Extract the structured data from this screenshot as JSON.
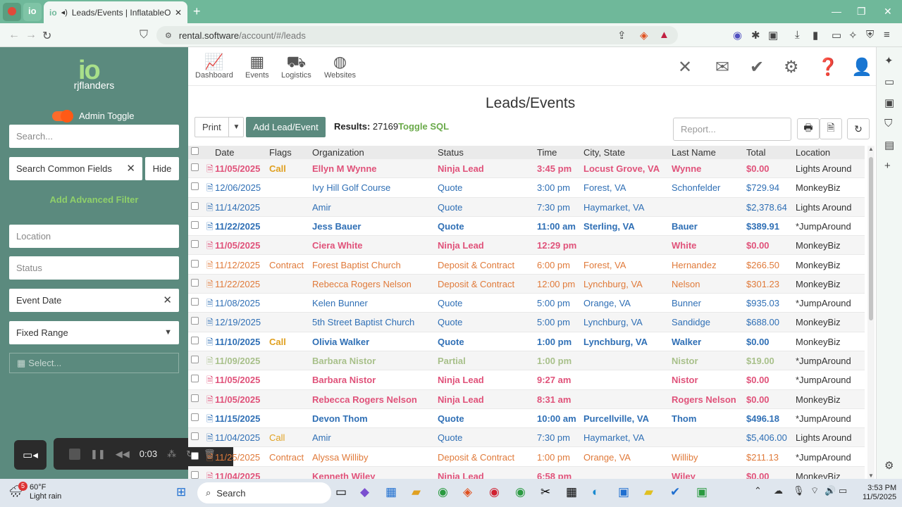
{
  "browser": {
    "tab_title": "Leads/Events | InflatableOffic",
    "url_host": "rental.software",
    "url_path": "/account/#/leads"
  },
  "sidebar": {
    "logo": "io",
    "username": "rjflanders",
    "admin_toggle_label": "Admin Toggle",
    "search_placeholder": "Search...",
    "common_fields_value": "Search Common Fields",
    "hide_label": "Hide",
    "advanced_filter_label": "Add Advanced Filter",
    "location_placeholder": "Location",
    "status_placeholder": "Status",
    "event_date_value": "Event Date",
    "range_selected": "Fixed Range",
    "select_placeholder": "Select..."
  },
  "recorder": {
    "time": "0:03"
  },
  "topnav": {
    "items": [
      "Dashboard",
      "Events",
      "Logistics",
      "Websites"
    ]
  },
  "page": {
    "title": "Leads/Events",
    "print_label": "Print",
    "add_label": "Add Lead/Event",
    "results_label": "Results:",
    "results_count": "27169",
    "toggle_sql_label": "Toggle SQL",
    "report_placeholder": "Report..."
  },
  "table": {
    "columns": [
      "Date",
      "Flags",
      "Organization",
      "Status",
      "Time",
      "City, State",
      "Last Name",
      "Total",
      "Location"
    ],
    "colors": {
      "ninja": "#e0527a",
      "quote": "#2f6fb5",
      "contract": "#e07a3a",
      "partial": "#a8c08a",
      "callflag": "#e0a020"
    },
    "rows": [
      {
        "date": "11/05/2025",
        "flag": "Call",
        "org": "Ellyn M Wynne",
        "status": "Ninja Lead",
        "time": "3:45 pm",
        "city": "Locust Grove, VA",
        "last": "Wynne",
        "total": "$0.00",
        "loc": "Lights Around",
        "kind": "ninja",
        "bold": true
      },
      {
        "date": "12/06/2025",
        "flag": "",
        "org": "Ivy Hill Golf Course",
        "status": "Quote",
        "time": "3:00 pm",
        "city": "Forest, VA",
        "last": "Schonfelder",
        "total": "$729.94",
        "loc": "MonkeyBiz",
        "kind": "quote",
        "bold": false
      },
      {
        "date": "11/14/2025",
        "flag": "",
        "org": "Amir",
        "status": "Quote",
        "time": "7:30 pm",
        "city": "Haymarket, VA",
        "last": "",
        "total": "$2,378.64",
        "loc": "Lights Around",
        "kind": "quote",
        "bold": false
      },
      {
        "date": "11/22/2025",
        "flag": "",
        "org": "Jess Bauer",
        "status": "Quote",
        "time": "11:00 am",
        "city": "Sterling, VA",
        "last": "Bauer",
        "total": "$389.91",
        "loc": "*JumpAround",
        "kind": "quote",
        "bold": true
      },
      {
        "date": "11/05/2025",
        "flag": "",
        "org": "Ciera White",
        "status": "Ninja Lead",
        "time": "12:29 pm",
        "city": "",
        "last": "White",
        "total": "$0.00",
        "loc": "MonkeyBiz",
        "kind": "ninja",
        "bold": true
      },
      {
        "date": "11/12/2025",
        "flag": "Contract",
        "org": "Forest Baptist Church",
        "status": "Deposit & Contract",
        "time": "6:00 pm",
        "city": "Forest, VA",
        "last": "Hernandez",
        "total": "$266.50",
        "loc": "MonkeyBiz",
        "kind": "contract",
        "bold": false
      },
      {
        "date": "11/22/2025",
        "flag": "",
        "org": "Rebecca Rogers Nelson",
        "status": "Deposit & Contract",
        "time": "12:00 pm",
        "city": "Lynchburg, VA",
        "last": "Nelson",
        "total": "$301.23",
        "loc": "MonkeyBiz",
        "kind": "contract",
        "bold": false
      },
      {
        "date": "11/08/2025",
        "flag": "",
        "org": "Kelen Bunner",
        "status": "Quote",
        "time": "5:00 pm",
        "city": "Orange, VA",
        "last": "Bunner",
        "total": "$935.03",
        "loc": "*JumpAround",
        "kind": "quote",
        "bold": false
      },
      {
        "date": "12/19/2025",
        "flag": "",
        "org": "5th Street Baptist Church",
        "status": "Quote",
        "time": "5:00 pm",
        "city": "Lynchburg, VA",
        "last": "Sandidge",
        "total": "$688.00",
        "loc": "MonkeyBiz",
        "kind": "quote",
        "bold": false
      },
      {
        "date": "11/10/2025",
        "flag": "Call",
        "org": "Olivia Walker",
        "status": "Quote",
        "time": "1:00 pm",
        "city": "Lynchburg, VA",
        "last": "Walker",
        "total": "$0.00",
        "loc": "MonkeyBiz",
        "kind": "quote",
        "bold": true
      },
      {
        "date": "11/09/2025",
        "flag": "",
        "org": "Barbara Nistor",
        "status": "Partial",
        "time": "1:00 pm",
        "city": "",
        "last": "Nistor",
        "total": "$19.00",
        "loc": "*JumpAround",
        "kind": "partial",
        "bold": true
      },
      {
        "date": "11/05/2025",
        "flag": "",
        "org": "Barbara Nistor",
        "status": "Ninja Lead",
        "time": "9:27 am",
        "city": "",
        "last": "Nistor",
        "total": "$0.00",
        "loc": "*JumpAround",
        "kind": "ninja",
        "bold": true
      },
      {
        "date": "11/05/2025",
        "flag": "",
        "org": "Rebecca Rogers Nelson",
        "status": "Ninja Lead",
        "time": "8:31 am",
        "city": "",
        "last": "Rogers Nelson",
        "total": "$0.00",
        "loc": "MonkeyBiz",
        "kind": "ninja",
        "bold": true
      },
      {
        "date": "11/15/2025",
        "flag": "",
        "org": "Devon Thom",
        "status": "Quote",
        "time": "10:00 am",
        "city": "Purcellville, VA",
        "last": "Thom",
        "total": "$496.18",
        "loc": "*JumpAround",
        "kind": "quote",
        "bold": true
      },
      {
        "date": "11/04/2025",
        "flag": "Call",
        "org": "Amir",
        "status": "Quote",
        "time": "7:30 pm",
        "city": "Haymarket, VA",
        "last": "",
        "total": "$5,406.00",
        "loc": "Lights Around",
        "kind": "quote",
        "bold": false
      },
      {
        "date": "11/25/2025",
        "flag": "Contract",
        "org": "Alyssa Williby",
        "status": "Deposit & Contract",
        "time": "1:00 pm",
        "city": "Orange, VA",
        "last": "Williby",
        "total": "$211.13",
        "loc": "*JumpAround",
        "kind": "contract",
        "bold": false
      },
      {
        "date": "11/04/2025",
        "flag": "",
        "org": "Kenneth Wiley",
        "status": "Ninja Lead",
        "time": "6:58 pm",
        "city": "",
        "last": "Wiley",
        "total": "$0.00",
        "loc": "MonkeyBiz",
        "kind": "ninja",
        "bold": true
      }
    ]
  },
  "taskbar": {
    "weather_badge": "5",
    "temp": "60°F",
    "condition": "Light rain",
    "search_label": "Search",
    "time": "3:53 PM",
    "date": "11/5/2025"
  }
}
